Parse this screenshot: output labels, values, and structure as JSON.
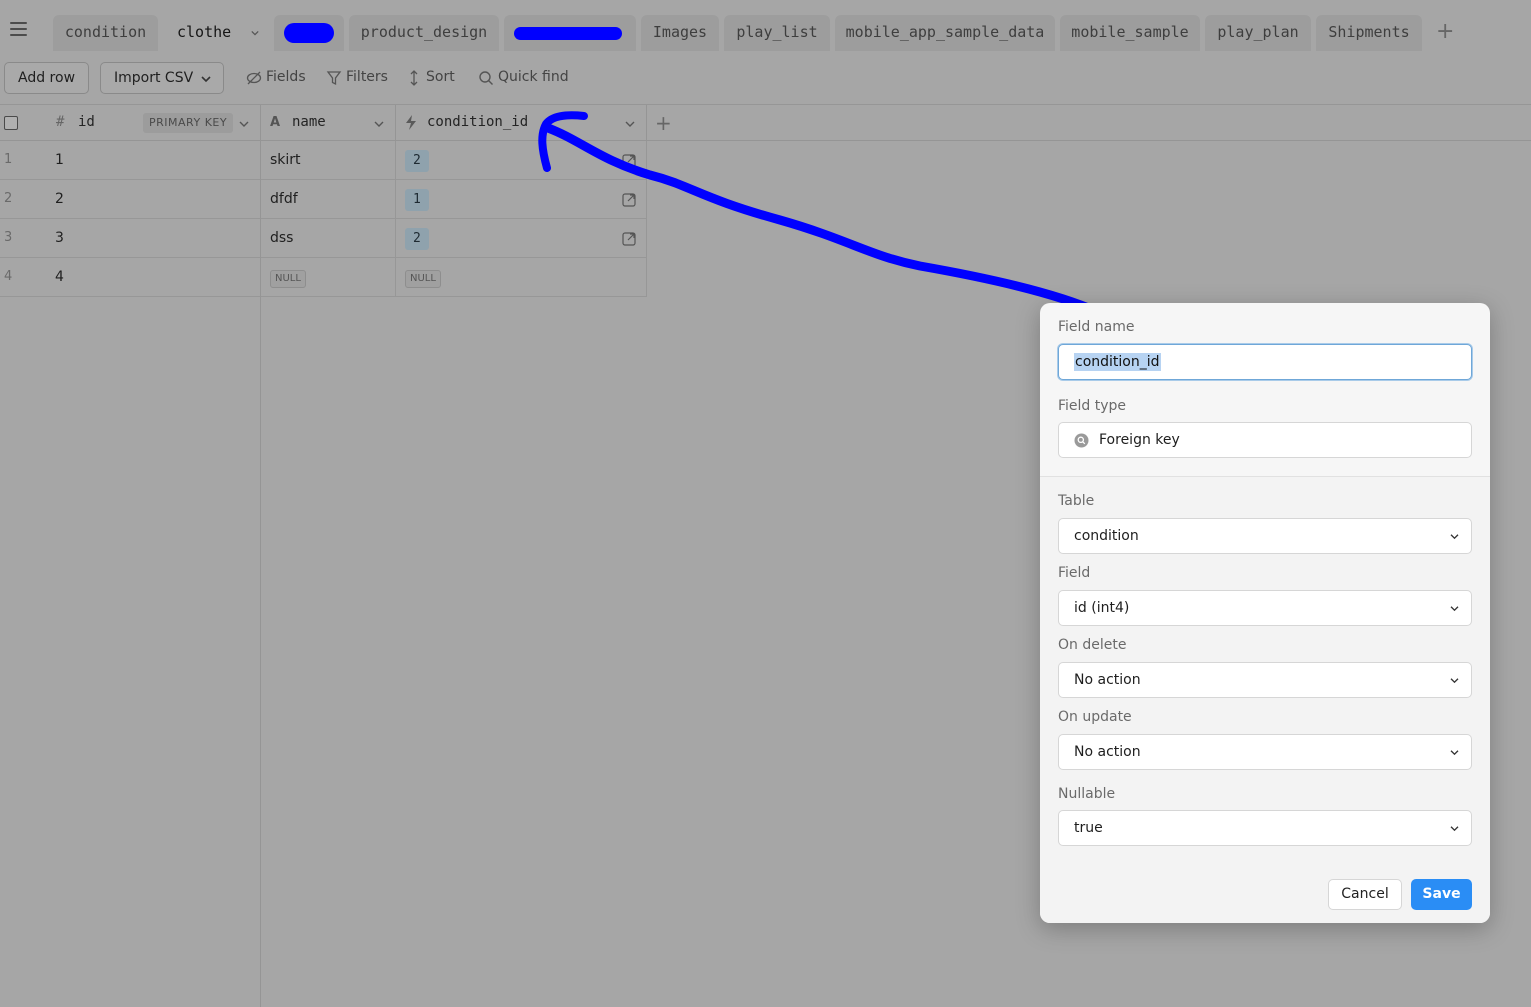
{
  "tabs": [
    {
      "label": "condition"
    },
    {
      "label": "clothe"
    },
    {
      "label": ""
    },
    {
      "label": "product_design"
    },
    {
      "label": ""
    },
    {
      "label": "Images"
    },
    {
      "label": "play_list"
    },
    {
      "label": "mobile_app_sample_data"
    },
    {
      "label": "mobile_sample"
    },
    {
      "label": "play_plan"
    },
    {
      "label": "Shipments"
    }
  ],
  "toolbar": {
    "add_row": "Add row",
    "import_csv": "Import CSV",
    "fields": "Fields",
    "filters": "Filters",
    "sort": "Sort",
    "quick_find": "Quick find"
  },
  "columns": {
    "id": {
      "label": "id",
      "badge": "PRIMARY KEY"
    },
    "name": {
      "label": "name"
    },
    "condition_id": {
      "label": "condition_id"
    }
  },
  "rows": [
    {
      "num": "1",
      "id": "1",
      "name": "skirt",
      "condition_id": "2"
    },
    {
      "num": "2",
      "id": "2",
      "name": "dfdf",
      "condition_id": "1"
    },
    {
      "num": "3",
      "id": "3",
      "name": "dss",
      "condition_id": "2"
    },
    {
      "num": "4",
      "id": "4",
      "name": "NULL",
      "condition_id": "NULL"
    }
  ],
  "dialog": {
    "field_name_label": "Field name",
    "field_name_value": "condition_id",
    "field_type_label": "Field type",
    "field_type_value": "Foreign key",
    "table_label": "Table",
    "table_value": "condition",
    "field_label": "Field",
    "field_value": "id (int4)",
    "on_delete_label": "On delete",
    "on_delete_value": "No action",
    "on_update_label": "On update",
    "on_update_value": "No action",
    "nullable_label": "Nullable",
    "nullable_value": "true",
    "cancel": "Cancel",
    "save": "Save"
  },
  "colors": {
    "annotation": "#0000ff",
    "accent": "#2a8df5",
    "overlay": "#a6a6a6"
  }
}
